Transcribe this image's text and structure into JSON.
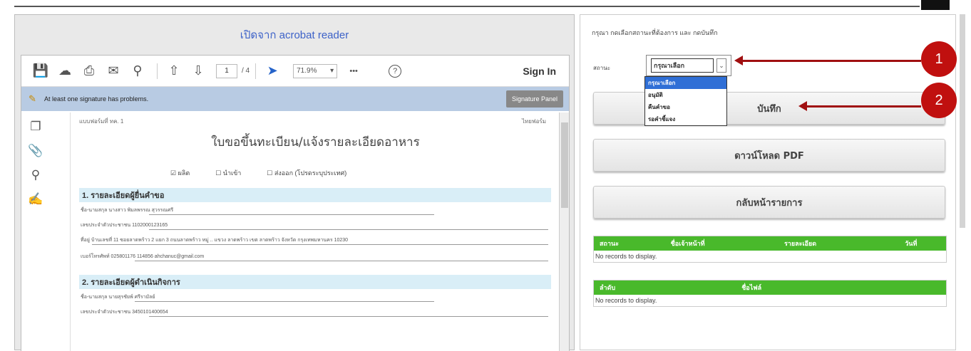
{
  "left_panel": {
    "title": "เปิดจาก acrobat reader",
    "toolbar": {
      "page_current": "1",
      "page_total": "/ 4",
      "zoom": "71.9%",
      "zoom_caret": "▾",
      "more": "•••",
      "help": "?",
      "sign_in": "Sign In"
    },
    "signature_bar": {
      "message": "At least one signature has problems.",
      "panel_button": "Signature Panel"
    },
    "document": {
      "form_no": "แบบฟอร์มที่ ทค. 1",
      "right_no": "ไทยฟอร์ม",
      "title": "ใบขอขึ้นทะเบียน/แจ้งรายละเอียดอาหาร",
      "checks": [
        "ผลิต",
        "นำเข้า",
        "ส่งออก (โปรดระบุประเทศ)"
      ],
      "section1": "1. รายละเอียดผู้ยื่นคำขอ",
      "section1_lines": [
        "ชื่อ-นามสกุล    นางสาว พิมลพรรณ สุวรรณศรี",
        "เลขประจำตัวประชาชน   1102000123165",
        "ที่อยู่ บ้านเลขที่ 11  ซอยลาดพร้าว 2 แยก 3 ถนนลาดพร้าว หมู่ .. แขวง ลาดพร้าว เขต ลาดพร้าว จังหวัด กรุงเทพมหานคร 10230",
        "เบอร์โทรศัพท์     025801176                         114856                   ahchanuc@gmail.com"
      ],
      "section2": "2. รายละเอียดผู้ดำเนินกิจการ",
      "section2_lines": [
        "ชื่อ-นามสกุล       นายสุรชัยพ์ ศรีรามัลย์",
        "เลขประจำตัวประชาชน    3450101400654"
      ]
    }
  },
  "right_panel": {
    "instruction": "กรุณา กดเลือกสถานะที่ต้องการ และ กดบันทึก",
    "status_label": "สถานะ",
    "select_value": "กรุณาเลือก",
    "dropdown_options": [
      "กรุณาเลือก",
      "อนุมัติ",
      "คืนคำขอ",
      "รอคำชี้แจง"
    ],
    "save_button": "บันทึก",
    "download_button": "ดาวน์โหลด PDF",
    "back_button": "กลับหน้ารายการ",
    "grid1": {
      "columns": [
        "สถานะ",
        "ชื่อเจ้าหน้าที่",
        "รายละเอียด",
        "วันที่"
      ],
      "empty": "No records to display."
    },
    "grid2": {
      "columns": [
        "ลำดับ",
        "ชื่อไฟล์"
      ],
      "empty": "No records to display."
    }
  },
  "annotations": [
    "1",
    "2"
  ],
  "colors": {
    "marker": "#c0100f",
    "grid_header": "#49b92b",
    "title_link": "#3d62c8",
    "dropdown_selected": "#2f6fd6"
  }
}
